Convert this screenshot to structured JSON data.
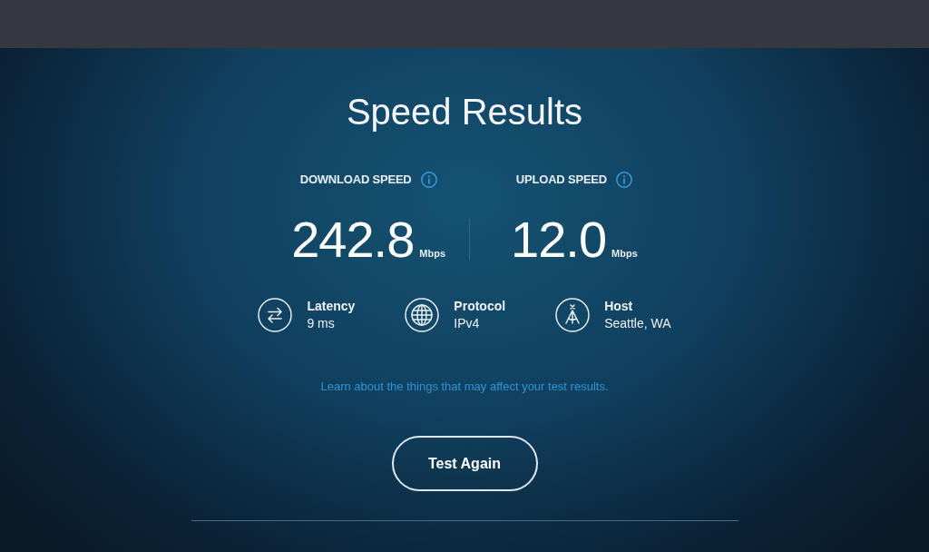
{
  "title": "Speed Results",
  "speeds": [
    {
      "label": "DOWNLOAD SPEED",
      "value": "242.8",
      "unit": "Mbps"
    },
    {
      "label": "UPLOAD SPEED",
      "value": "12.0",
      "unit": "Mbps"
    }
  ],
  "stats": [
    {
      "kind": "latency",
      "label": "Latency",
      "value": "9 ms"
    },
    {
      "kind": "protocol",
      "label": "Protocol",
      "value": "IPv4"
    },
    {
      "kind": "host",
      "label": "Host",
      "value": "Seattle, WA"
    }
  ],
  "link": "Learn about the things that may affect your test results.",
  "button": "Test Again"
}
